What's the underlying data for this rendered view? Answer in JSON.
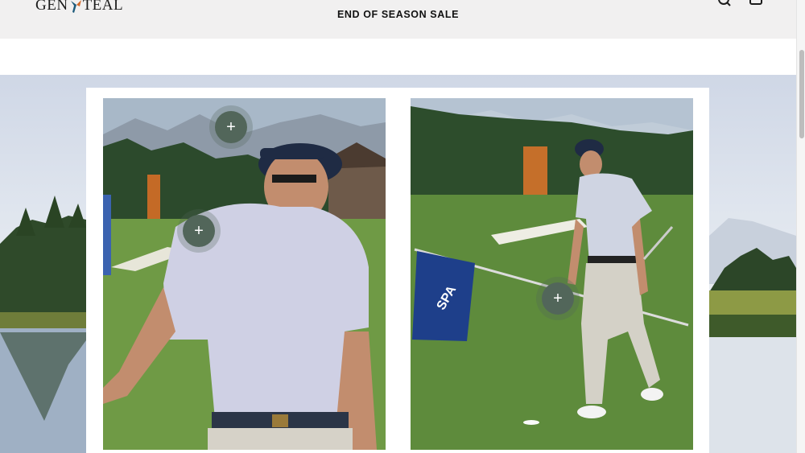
{
  "header": {
    "logo_text_left": "GEN",
    "logo_text_right": "TEAL",
    "promo": "END OF SEASON SALE",
    "icons": [
      "search-icon",
      "shopping-bag-icon"
    ]
  },
  "colors": {
    "header_bg": "#f1f0f0",
    "hotspot": "#52665a",
    "grass": "#5e8b3c",
    "flag": "#1e3f8a"
  },
  "flag": {
    "text": "SPA"
  },
  "hotspots": [
    {
      "label": "+"
    },
    {
      "label": "+"
    },
    {
      "label": "+"
    }
  ]
}
